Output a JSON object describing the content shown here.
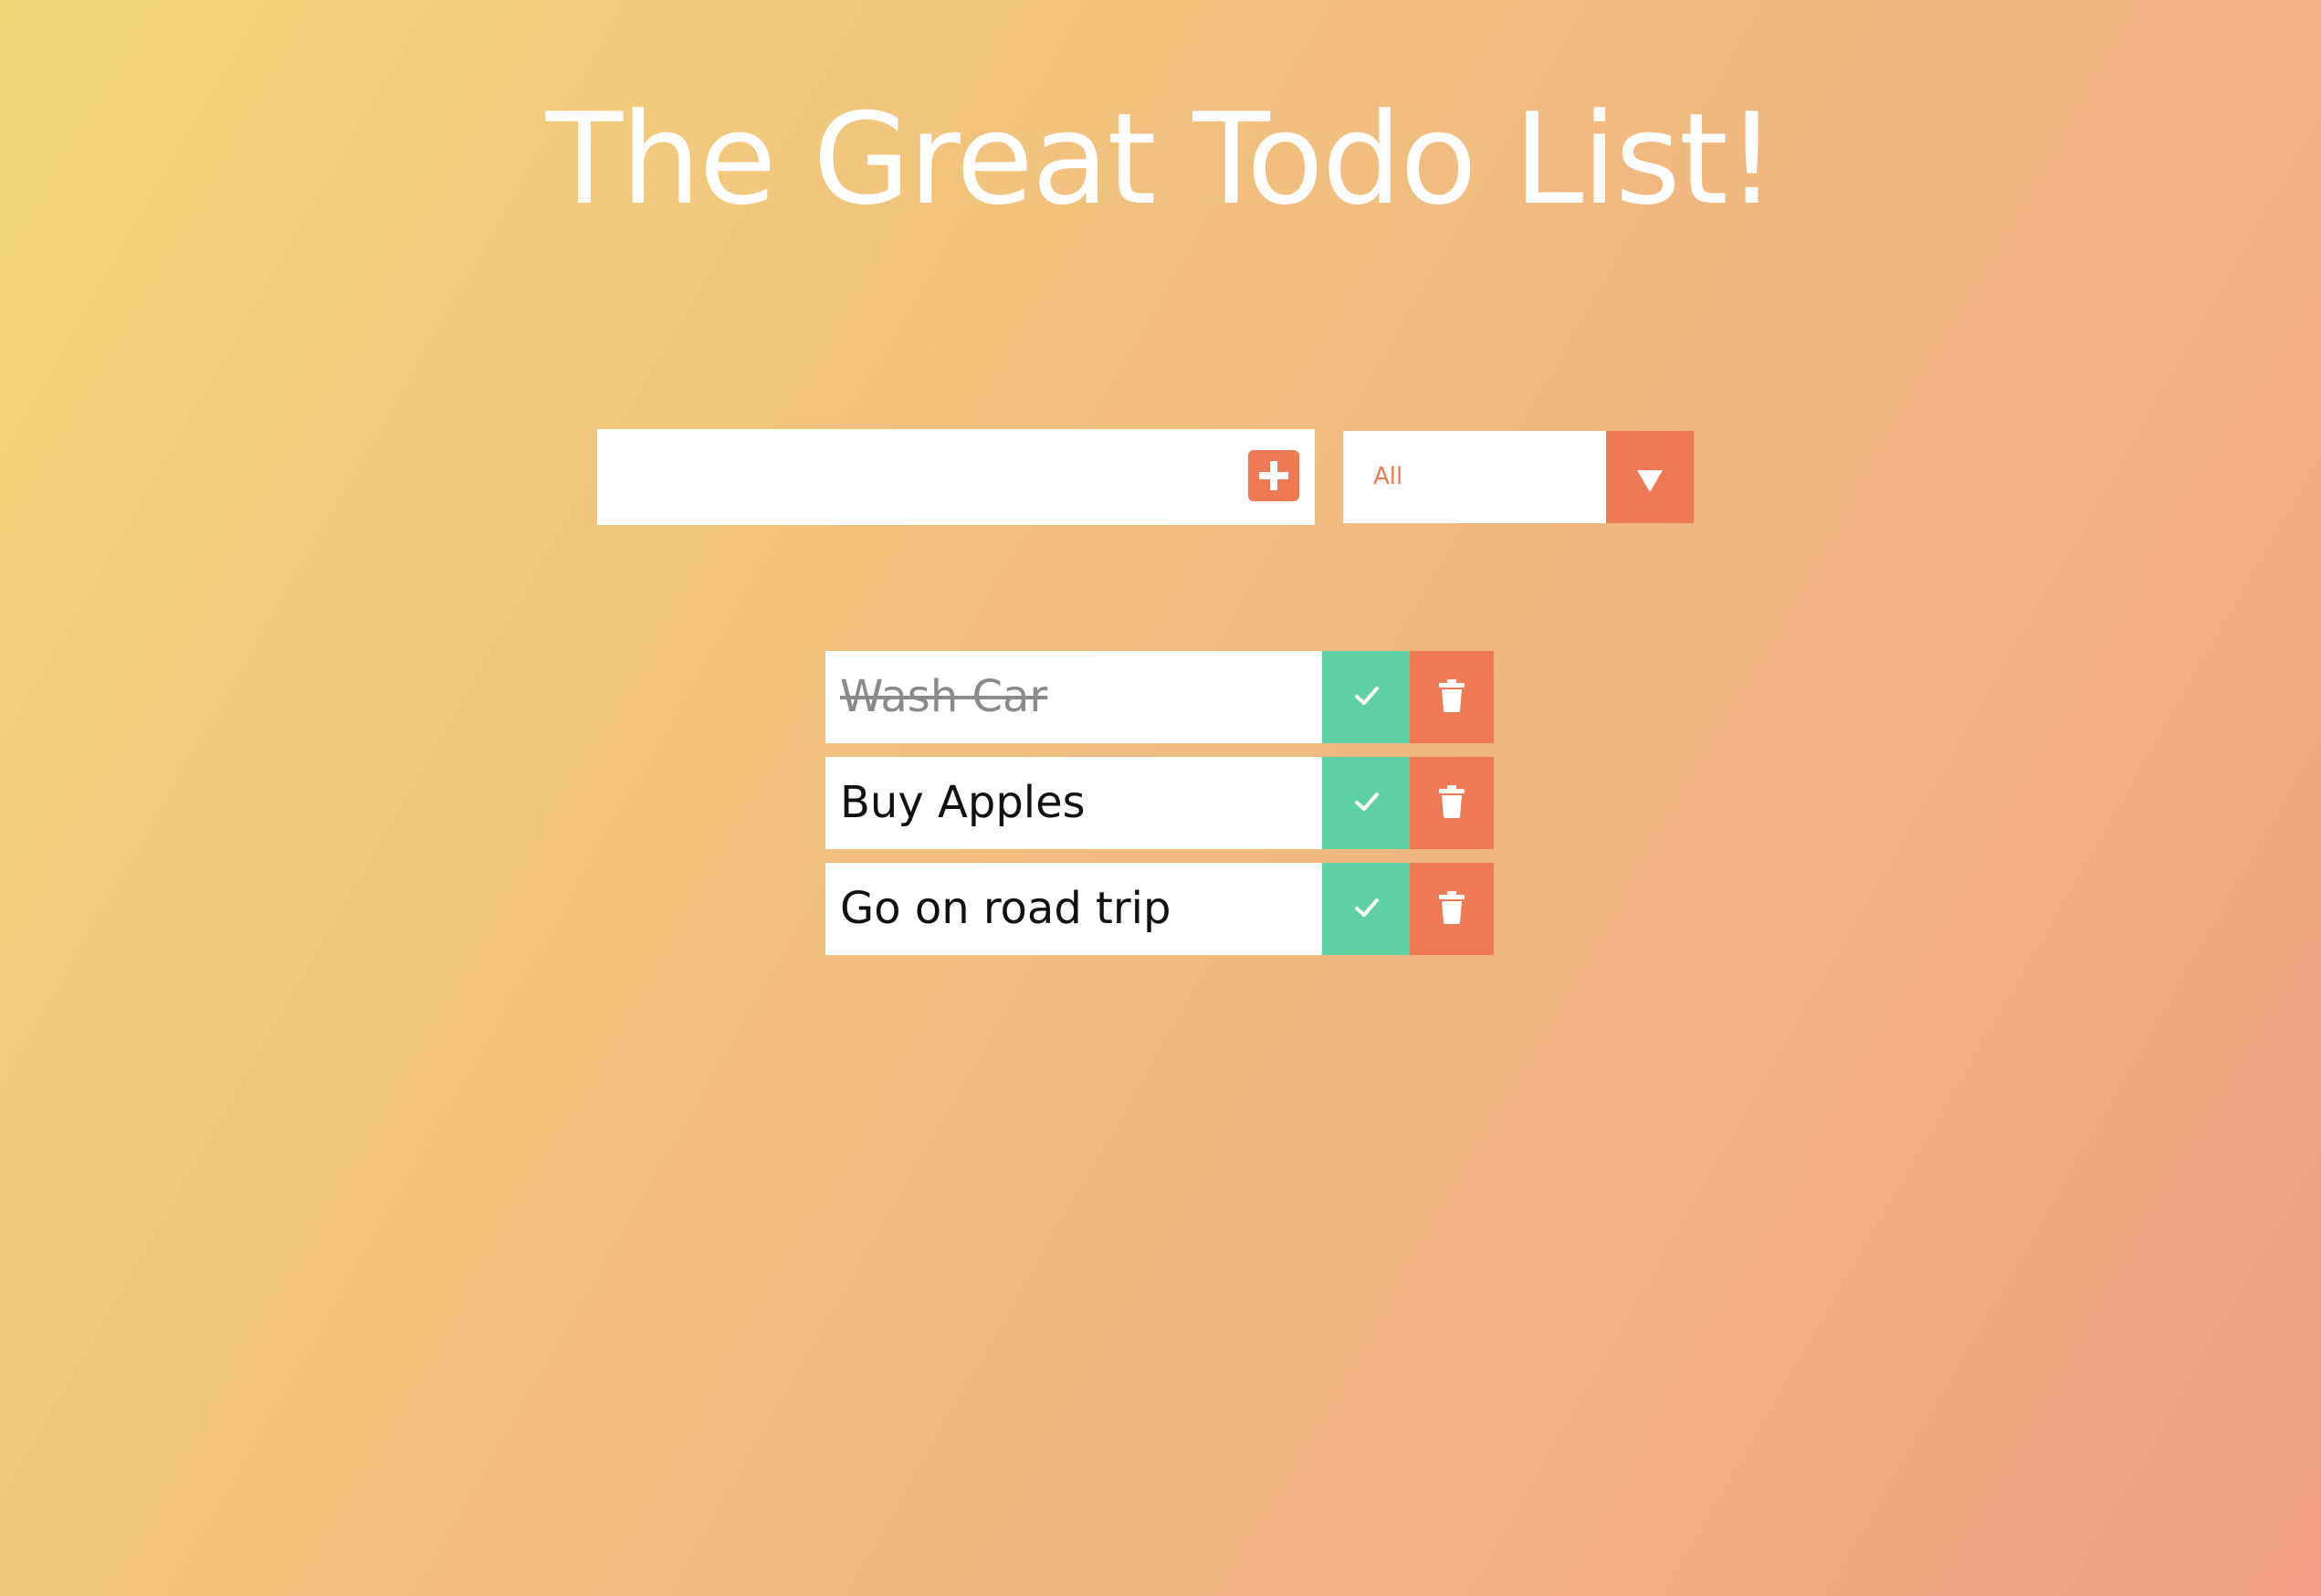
{
  "app": {
    "title": "The Great Todo List!"
  },
  "form": {
    "input_value": "",
    "input_placeholder": "",
    "add_icon": "plus-square-icon",
    "filter": {
      "selected": "All",
      "options": [
        "All"
      ],
      "icon": "caret-down-icon"
    }
  },
  "todos": [
    {
      "text": "Wash Car",
      "completed": true
    },
    {
      "text": "Buy Apples",
      "completed": false
    },
    {
      "text": "Go on road trip",
      "completed": false
    }
  ],
  "colors": {
    "accent": "#ee7a55",
    "complete": "#5fd0a4",
    "gradient_start": "#f2d67a",
    "gradient_end": "#f0a084"
  }
}
